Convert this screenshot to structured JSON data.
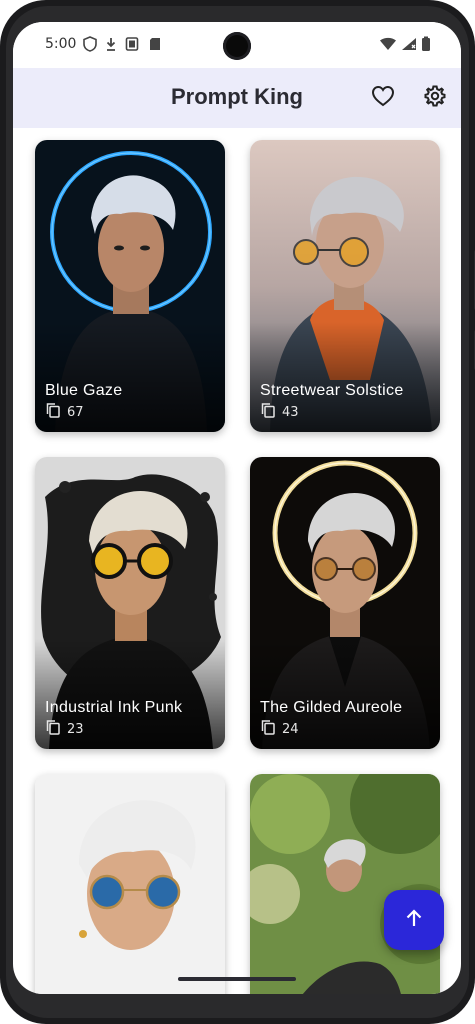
{
  "status": {
    "time": "5:00"
  },
  "app": {
    "title": "Prompt King"
  },
  "cards": [
    {
      "title": "Blue Gaze",
      "count": "67"
    },
    {
      "title": "Streetwear Solstice",
      "count": "43"
    },
    {
      "title": "Industrial Ink Punk",
      "count": "23"
    },
    {
      "title": "The Gilded Aureole",
      "count": "24"
    },
    {
      "title": "",
      "count": ""
    },
    {
      "title": "",
      "count": ""
    }
  ],
  "icons": {
    "favorites": "heart-outline-icon",
    "settings": "gear-icon",
    "copy": "copy-icon",
    "scroll_top": "arrow-up-icon"
  },
  "colors": {
    "appbar": "#ececfa",
    "fab": "#2b27d9"
  }
}
